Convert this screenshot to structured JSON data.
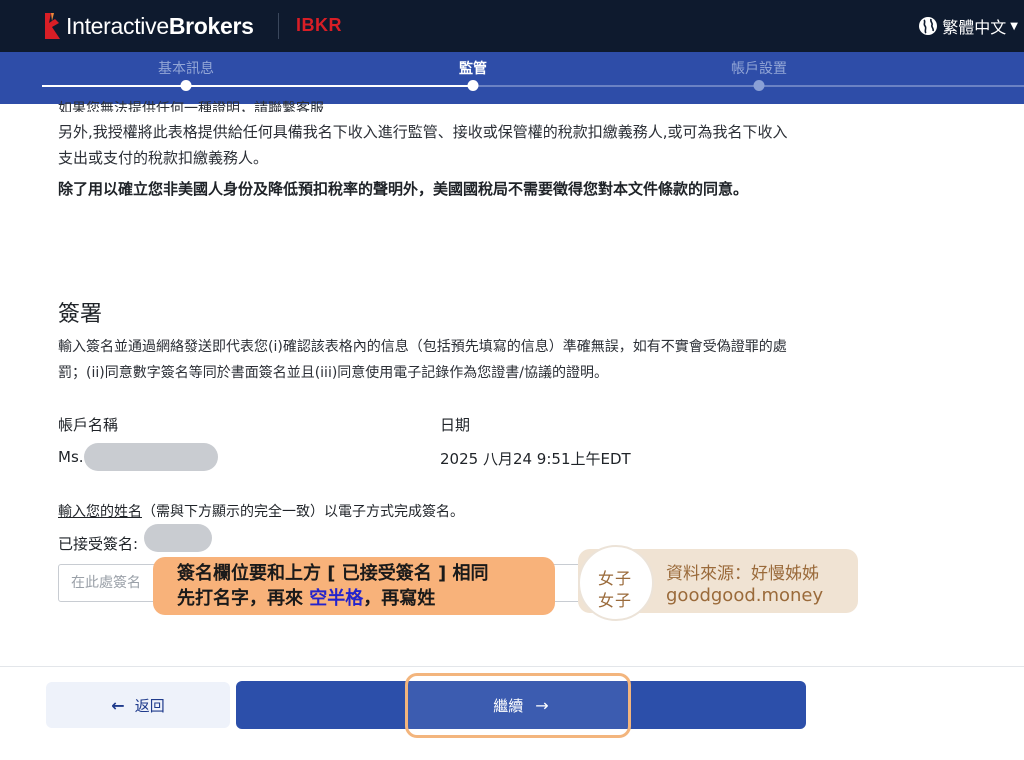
{
  "header": {
    "logo_regular": "Interactive",
    "logo_bold": "Brokers",
    "ticker": "IBKR",
    "language": "繁體中文",
    "language_icon": "globe-icon",
    "caret_icon": "caret-down-icon"
  },
  "stepper": {
    "steps": [
      {
        "label": "基本訊息",
        "state": "complete"
      },
      {
        "label": "監管",
        "state": "active"
      },
      {
        "label": "帳戶設置",
        "state": "upcoming"
      }
    ]
  },
  "body": {
    "cut_line": "如果您無法提供任何一種證明，請聯繫客服",
    "para1": "另外,我授權將此表格提供給任何具備我名下收入進行監管、接收或保管權的稅款扣繳義務人,或可為我名下收入支出或支付的稅款扣繳義務人。",
    "para2": "除了用以確立您非美國人身份及降低預扣稅率的聲明外，美國國稅局不需要徵得您對本文件條款的同意。",
    "signature_heading": "簽署",
    "signature_desc": "輸入簽名並通過網絡發送即代表您(i)確認該表格內的信息（包括預先填寫的信息）準確無誤，如有不實會受偽證罪的處罰；(ii)同意數字簽名等同於書面簽名並且(iii)同意使用電子記錄作為您證書/協議的證明。",
    "account_name_label": "帳戶名稱",
    "account_name_prefix": "Ms.",
    "date_label": "日期",
    "date_value": "2025 八月24 9:51上午EDT",
    "instruction_link": "輸入您的姓名",
    "instruction_rest": "（需與下方顯示的完全一致）以電子方式完成簽名。",
    "accepted_signature_label": "已接受簽名:",
    "signature_placeholder": "在此處簽名"
  },
  "overlay": {
    "callout_line1": "簽名欄位要和上方 [ 已接受簽名 ] 相同",
    "callout_line2_a": "先打名字，再來 ",
    "callout_line2_hl": "空半格",
    "callout_line2_b": "，再寫姓",
    "brand_l1": "女子",
    "brand_l2": "女子",
    "source": "資料來源：好慢姊姊",
    "url": "goodgood.money"
  },
  "footer": {
    "back_label": "返回",
    "back_icon": "arrow-left-icon",
    "continue_label": "繼續",
    "continue_icon": "arrow-right-icon"
  },
  "colors": {
    "header_bg": "#0e1a2e",
    "stepper_bg": "#2e4da8",
    "primary": "#2c4faa",
    "ibkr_red": "#d81e26",
    "callout": "#f8b27a",
    "highlight_text": "#2323cc"
  }
}
